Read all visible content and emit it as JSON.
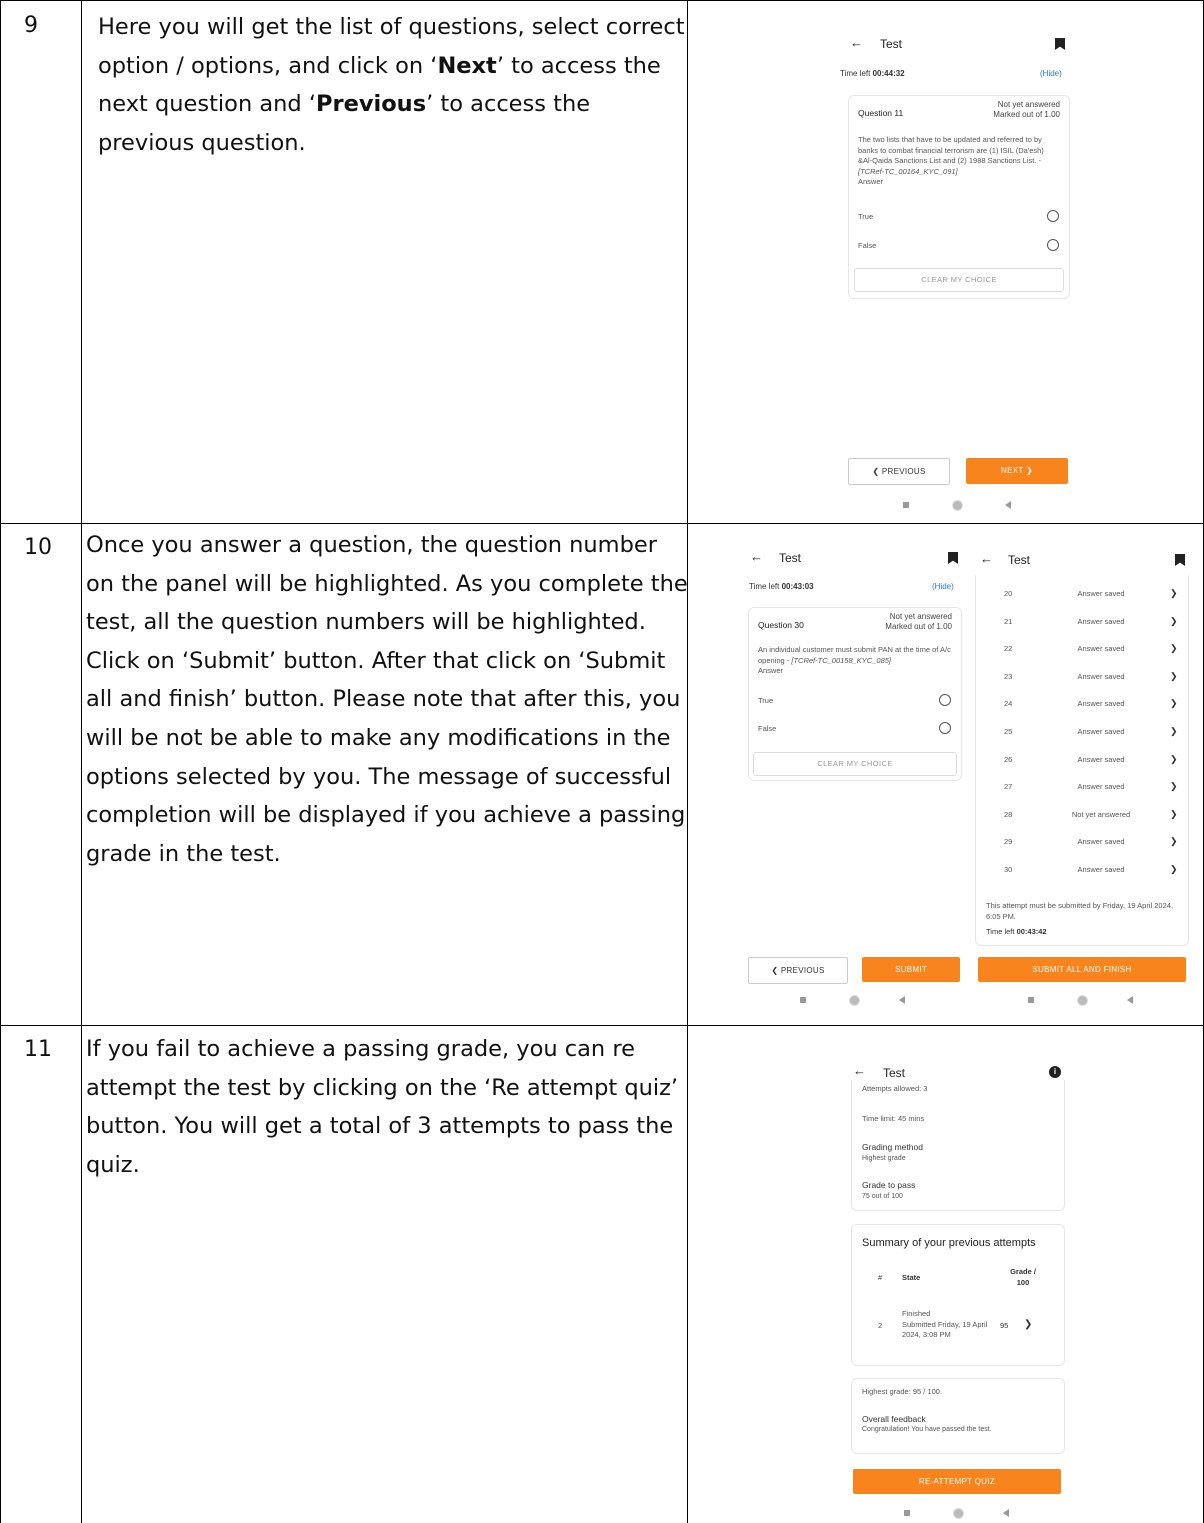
{
  "rows": [
    {
      "number": "9",
      "text": {
        "p1": "Here you will get the list of questions, select correct option / options, and click on ",
        "next": "Next",
        "p2": " to access the next question and ",
        "previous": "Previous",
        "p3": " to access the previous question."
      }
    },
    {
      "number": "10",
      "text": "Once you answer a question, the question number on the panel will be highlighted. As you complete the test, all the question numbers will be highlighted. Click on ‘Submit’ button. After that click on ‘Submit all and finish’ button. Please note that after this, you will be not be able to make any modifications in the options selected by you. The message of successful completion will be displayed if you achieve a passing grade in the test."
    },
    {
      "number": "11",
      "text": "If you fail to achieve a passing grade, you can re attempt the test by clicking on the ‘Re attempt quiz’ button. You will get a total of 3 attempts to pass the quiz."
    }
  ],
  "screen1": {
    "title": "Test",
    "time_left_label": "Time left",
    "time_left": "00:44:32",
    "hide": "(Hide)",
    "question_label": "Question 11",
    "status": "Not yet answered",
    "marked": "Marked out of 1.00",
    "question_text": "The two lists that have to be updated and referred to by banks to combat financial terrorism are (1) ISIL (Da'esh) &Al-Qaida Sanctions List and (2) 1988 Sanctions List. - ",
    "question_ref": "[TCRef-TC_00164_KYC_091]",
    "answer_label": "Answer",
    "option_true": "True",
    "option_false": "False",
    "clear": "CLEAR MY CHOICE",
    "prev_btn": "PREVIOUS",
    "next_btn": "NEXT"
  },
  "screen2": {
    "title": "Test",
    "time_left_label": "Time left",
    "time_left": "00:43:03",
    "hide": "(Hide)",
    "question_label": "Question 30",
    "status": "Not yet answered",
    "marked": "Marked out of 1.00",
    "question_text": "An individual customer must submit PAN at the time of A/c opening - ",
    "question_ref": "[TCRef-TC_00158_KYC_085]",
    "answer_label": "Answer",
    "option_true": "True",
    "option_false": "False",
    "clear": "CLEAR MY CHOICE",
    "prev_btn": "PREVIOUS",
    "submit_btn": "SUBMIT"
  },
  "screen3": {
    "title": "Test",
    "rows": [
      {
        "n": "20",
        "s": "Answer saved"
      },
      {
        "n": "21",
        "s": "Answer saved"
      },
      {
        "n": "22",
        "s": "Answer saved"
      },
      {
        "n": "23",
        "s": "Answer saved"
      },
      {
        "n": "24",
        "s": "Answer saved"
      },
      {
        "n": "25",
        "s": "Answer saved"
      },
      {
        "n": "26",
        "s": "Answer saved"
      },
      {
        "n": "27",
        "s": "Answer saved"
      },
      {
        "n": "28",
        "s": "Not yet answered"
      },
      {
        "n": "29",
        "s": "Answer saved"
      },
      {
        "n": "30",
        "s": "Answer saved"
      }
    ],
    "deadline": "This attempt must be submitted by Friday, 19 April 2024, 6:05 PM.",
    "time_left_label": "Time left",
    "time_left": "00:43:42",
    "submit_all_btn": "SUBMIT ALL AND FINISH"
  },
  "screen4": {
    "title": "Test",
    "attempts_allowed": "Attempts allowed: 3",
    "time_limit": "Time limit: 45 mins",
    "grading_method_label": "Grading method",
    "grading_method": "Highest grade",
    "grade_to_pass_label": "Grade to pass",
    "grade_to_pass": "75 out of 100",
    "summary_title": "Summary of your previous attempts",
    "col_hash": "#",
    "col_state": "State",
    "col_grade": "Grade / 100",
    "attempt_num": "2",
    "attempt_state": "Finished",
    "attempt_submitted": "Submitted Friday, 19 April 2024, 3:08 PM",
    "attempt_grade": "95",
    "highest_grade": "Highest grade: 95 / 100.",
    "feedback_label": "Overall feedback",
    "feedback": "Congratulation! You have passed the test.",
    "reattempt_btn": "RE-ATTEMPT QUIZ"
  },
  "colors": {
    "accent": "#f7841c",
    "link": "#2a78c7"
  }
}
